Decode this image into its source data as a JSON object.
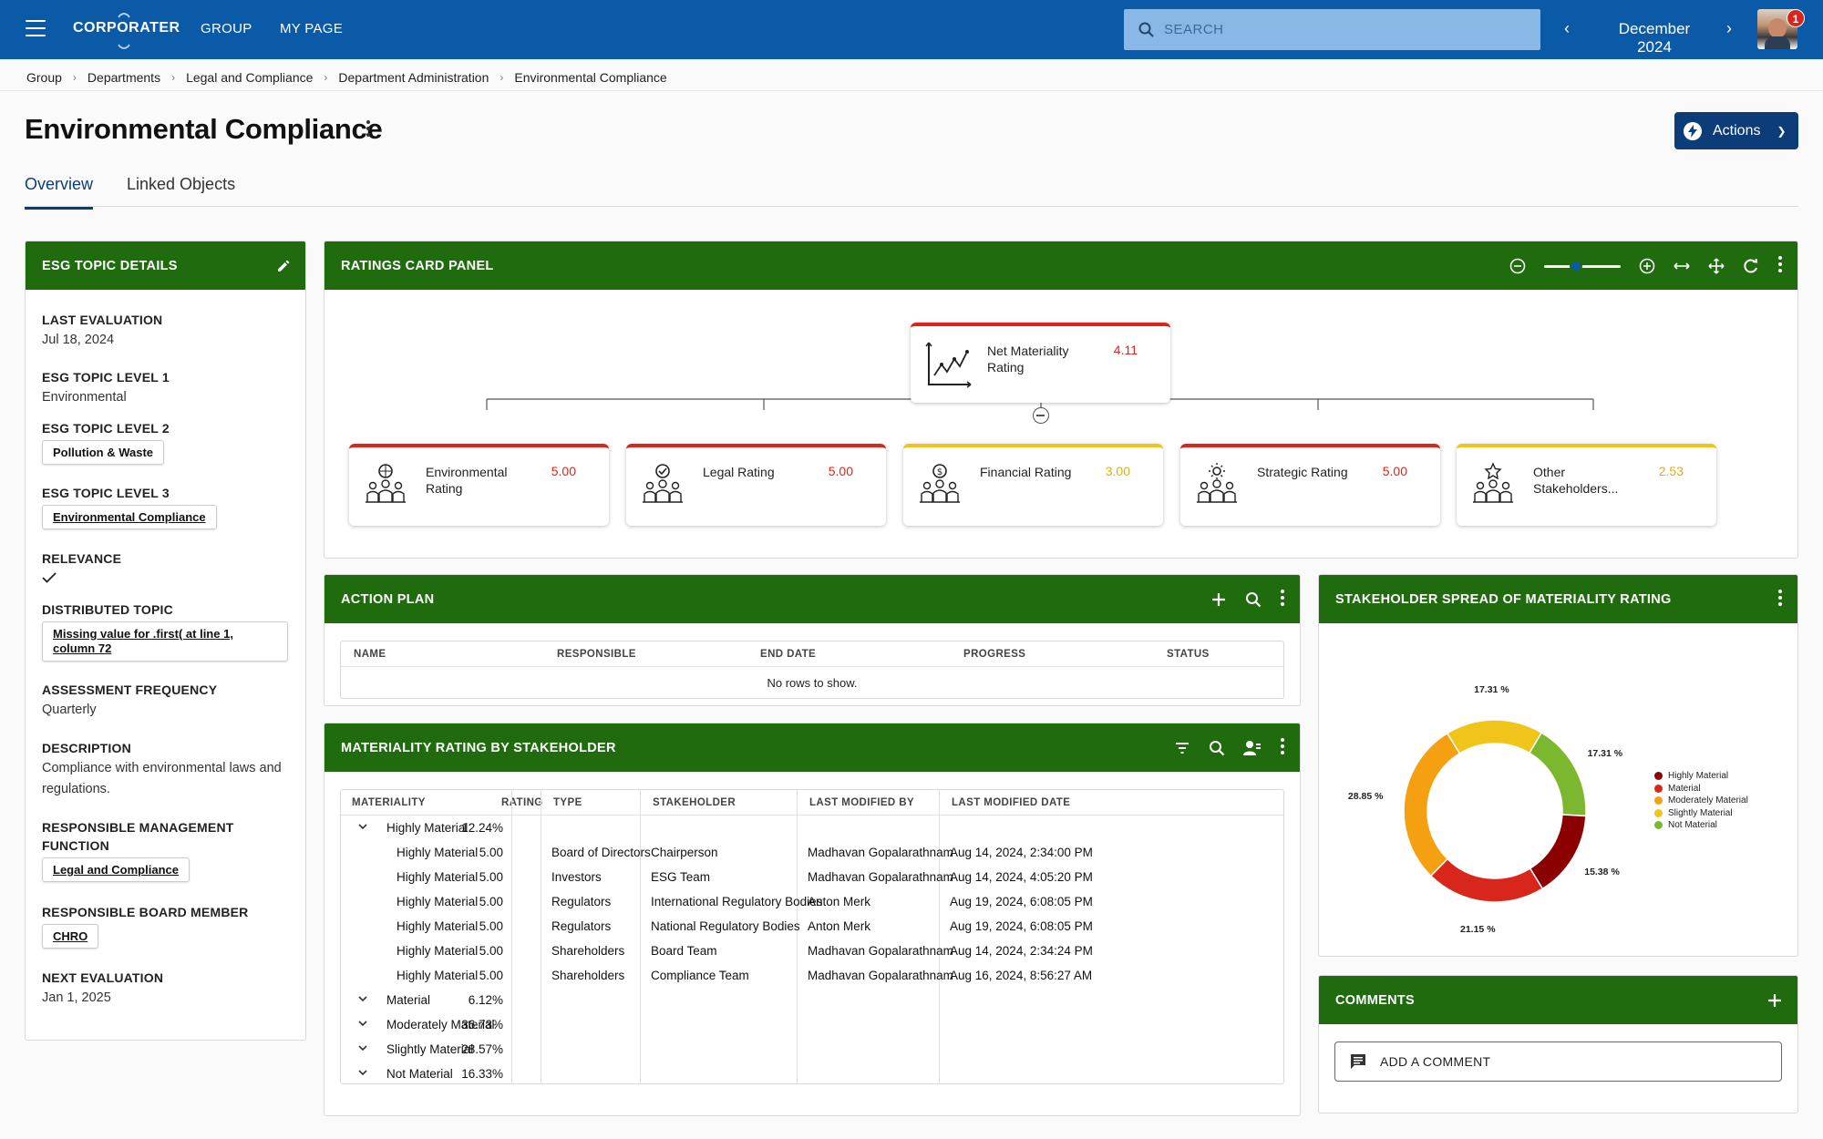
{
  "topbar": {
    "logo": "CORPORATER",
    "nav": [
      "GROUP",
      "MY PAGE"
    ],
    "search_placeholder": "SEARCH",
    "date": "December 2024",
    "notifications": "1"
  },
  "breadcrumb": [
    "Group",
    "Departments",
    "Legal and Compliance",
    "Department Administration",
    "Environmental Compliance"
  ],
  "page": {
    "title": "Environmental Compliance",
    "actions_label": "Actions",
    "tabs": [
      "Overview",
      "Linked Objects"
    ]
  },
  "esg": {
    "header": "ESG TOPIC DETAILS",
    "last_eval_k": "LAST EVALUATION",
    "last_eval_v": "Jul 18, 2024",
    "l1_k": "ESG TOPIC LEVEL 1",
    "l1_v": "Environmental",
    "l2_k": "ESG TOPIC LEVEL 2",
    "l2_v": "Pollution & Waste",
    "l3_k": "ESG TOPIC LEVEL 3",
    "l3_v": "Environmental Compliance",
    "relevance_k": "RELEVANCE",
    "dist_k": "DISTRIBUTED TOPIC",
    "dist_v": "Missing value for .first( at line 1, column 72",
    "freq_k": "ASSESSMENT FREQUENCY",
    "freq_v": "Quarterly",
    "desc_k": "DESCRIPTION",
    "desc_v": "Compliance with environmental laws and regulations.",
    "rmf_k1": "RESPONSIBLE MANAGEMENT",
    "rmf_k2": "FUNCTION",
    "rmf_v": "Legal and Compliance",
    "rbm_k": "RESPONSIBLE BOARD MEMBER",
    "rbm_v": "CHRO",
    "next_k": "NEXT EVALUATION",
    "next_v": "Jan 1, 2025"
  },
  "ratings": {
    "header": "RATINGS CARD PANEL",
    "zoom_percent": 40,
    "top": {
      "name": "Net Materiality Rating",
      "value": "4.11"
    },
    "cards": [
      {
        "name": "Environmental Rating",
        "value": "5.00",
        "color": "#d9261c"
      },
      {
        "name": "Legal Rating",
        "value": "5.00",
        "color": "#d9261c"
      },
      {
        "name": "Financial Rating",
        "value": "3.00",
        "color": "#f0c419"
      },
      {
        "name": "Strategic Rating",
        "value": "5.00",
        "color": "#d9261c"
      },
      {
        "name": "Other Stakeholders...",
        "value": "2.53",
        "color": "#f0c419"
      }
    ]
  },
  "action_plan": {
    "header": "ACTION PLAN",
    "columns": [
      "NAME",
      "RESPONSIBLE",
      "END DATE",
      "PROGRESS",
      "STATUS"
    ],
    "empty": "No rows to show."
  },
  "materiality": {
    "header": "MATERIALITY RATING BY STAKEHOLDER",
    "columns": [
      "MATERIALITY",
      "RATING",
      "TYPE",
      "STAKEHOLDER",
      "LAST MODIFIED BY",
      "LAST MODIFIED DATE"
    ],
    "rows": [
      {
        "m": "Highly Material",
        "r": "12.24%",
        "t": "",
        "s": "",
        "b": "",
        "d": "",
        "group": true
      },
      {
        "m": "Highly Material",
        "r": "5.00",
        "t": "Board of Directors",
        "s": "Chairperson",
        "b": "Madhavan Gopalarathnam",
        "d": "Aug 14, 2024, 2:34:00 PM"
      },
      {
        "m": "Highly Material",
        "r": "5.00",
        "t": "Investors",
        "s": "ESG Team",
        "b": "Madhavan Gopalarathnam",
        "d": "Aug 14, 2024, 4:05:20 PM"
      },
      {
        "m": "Highly Material",
        "r": "5.00",
        "t": "Regulators",
        "s": "International Regulatory Bodies",
        "b": "Anton Merk",
        "d": "Aug 19, 2024, 6:08:05 PM"
      },
      {
        "m": "Highly Material",
        "r": "5.00",
        "t": "Regulators",
        "s": "National Regulatory Bodies",
        "b": "Anton Merk",
        "d": "Aug 19, 2024, 6:08:05 PM"
      },
      {
        "m": "Highly Material",
        "r": "5.00",
        "t": "Shareholders",
        "s": "Board Team",
        "b": "Madhavan Gopalarathnam",
        "d": "Aug 14, 2024, 2:34:24 PM"
      },
      {
        "m": "Highly Material",
        "r": "5.00",
        "t": "Shareholders",
        "s": "Compliance Team",
        "b": "Madhavan Gopalarathnam",
        "d": "Aug 16, 2024, 8:56:27 AM"
      },
      {
        "m": "Material",
        "r": "6.12%",
        "t": "",
        "s": "",
        "b": "",
        "d": "",
        "group": true
      },
      {
        "m": "Moderately Material",
        "r": "36.73%",
        "t": "",
        "s": "",
        "b": "",
        "d": "",
        "group": true
      },
      {
        "m": "Slightly Material",
        "r": "28.57%",
        "t": "",
        "s": "",
        "b": "",
        "d": "",
        "group": true
      },
      {
        "m": "Not Material",
        "r": "16.33%",
        "t": "",
        "s": "",
        "b": "",
        "d": "",
        "group": true
      }
    ]
  },
  "spread": {
    "header": "STAKEHOLDER SPREAD OF MATERIALITY RATING",
    "chart_data": {
      "type": "pie",
      "categories": [
        "Not Material",
        "Slightly Material",
        "Highly Material",
        "Material",
        "Moderately Material"
      ],
      "values": [
        17.31,
        17.31,
        15.38,
        21.15,
        28.85
      ],
      "colors": [
        "#f0c419",
        "#7cb82f",
        "#8b0000",
        "#d9261c",
        "#f5a010"
      ],
      "labels": [
        "17.31 %",
        "17.31 %",
        "15.38 %",
        "21.15 %",
        "28.85 %"
      ],
      "legend": [
        "Highly Material",
        "Material",
        "Moderately Material",
        "Slightly Material",
        "Not Material"
      ],
      "legend_colors": [
        "#8b0000",
        "#d9261c",
        "#f5a010",
        "#f0c419",
        "#7cb82f"
      ],
      "legend_position": "right"
    }
  },
  "comments": {
    "header": "COMMENTS",
    "add_label": "ADD A COMMENT"
  }
}
